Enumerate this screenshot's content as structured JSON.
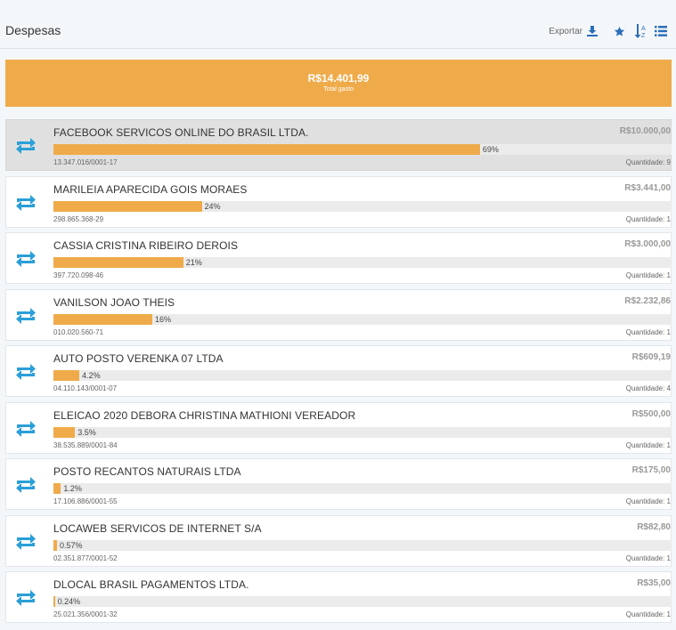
{
  "header": {
    "title": "Despesas",
    "export_label": "Exportar",
    "icons": [
      "download-icon",
      "star-icon",
      "sort-alpha-icon",
      "list-icon"
    ],
    "accent_color": "#2c6fb7"
  },
  "summary": {
    "value": "R$14.401,99",
    "label": "Total gasto",
    "color": "#efab4a"
  },
  "items": [
    {
      "name": "FACEBOOK SERVICOS ONLINE DO BRASIL LTDA.",
      "amount": "R$10.000,00",
      "percent_label": "69%",
      "percent": 69,
      "document": "13.347.016/0001-17",
      "quantity": "Quantidade: 9",
      "selected": true
    },
    {
      "name": "MARILEIA APARECIDA GOIS MORAES",
      "amount": "R$3.441,00",
      "percent_label": "24%",
      "percent": 24,
      "document": "298.865.368-29",
      "quantity": "Quantidade: 1",
      "selected": false
    },
    {
      "name": "CASSIA CRISTINA RIBEIRO DEROIS",
      "amount": "R$3.000,00",
      "percent_label": "21%",
      "percent": 21,
      "document": "397.720.098-46",
      "quantity": "Quantidade: 1",
      "selected": false
    },
    {
      "name": "VANILSON JOAO THEIS",
      "amount": "R$2.232,86",
      "percent_label": "16%",
      "percent": 16,
      "document": "010.020.560-71",
      "quantity": "Quantidade: 1",
      "selected": false
    },
    {
      "name": "AUTO POSTO VERENKA 07 LTDA",
      "amount": "R$609,19",
      "percent_label": "4.2%",
      "percent": 4.2,
      "document": "04.110.143/0001-07",
      "quantity": "Quantidade: 4",
      "selected": false
    },
    {
      "name": "ELEICAO 2020 DEBORA CHRISTINA MATHIONI VEREADOR",
      "amount": "R$500,00",
      "percent_label": "3.5%",
      "percent": 3.5,
      "document": "38.535.889/0001-84",
      "quantity": "Quantidade: 1",
      "selected": false
    },
    {
      "name": "POSTO RECANTOS NATURAIS LTDA",
      "amount": "R$175,00",
      "percent_label": "1.2%",
      "percent": 1.2,
      "document": "17.106.886/0001-55",
      "quantity": "Quantidade: 1",
      "selected": false
    },
    {
      "name": "LOCAWEB SERVICOS DE INTERNET S/A",
      "amount": "R$82,80",
      "percent_label": "0.57%",
      "percent": 0.57,
      "document": "02.351.877/0001-52",
      "quantity": "Quantidade: 1",
      "selected": false
    },
    {
      "name": "DLOCAL BRASIL PAGAMENTOS LTDA.",
      "amount": "R$35,00",
      "percent_label": "0.24%",
      "percent": 0.24,
      "document": "25.021.356/0001-32",
      "quantity": "Quantidade: 1",
      "selected": false
    }
  ]
}
